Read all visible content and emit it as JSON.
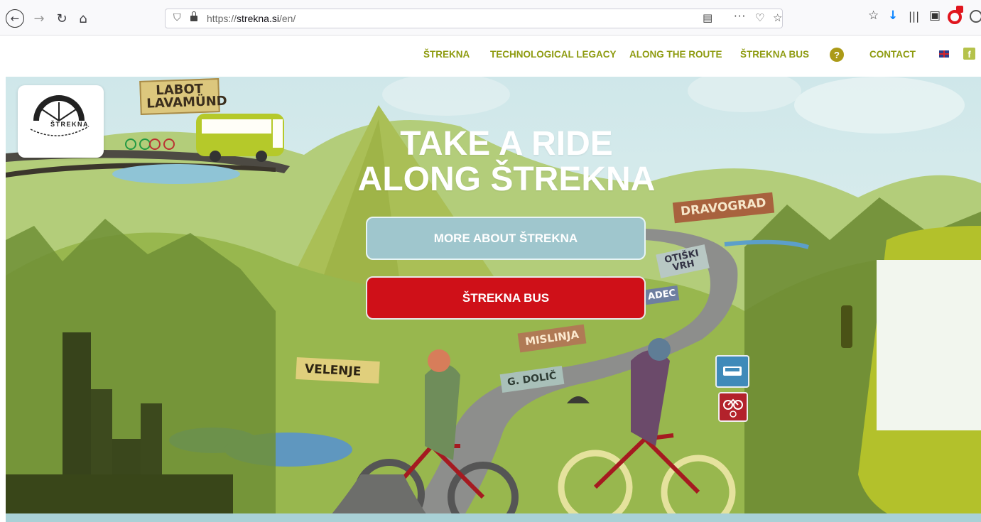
{
  "browser": {
    "url_prefix": "https://",
    "url_domain": "strekna.si",
    "url_path": "/en/",
    "icons": [
      "back-icon",
      "forward-icon",
      "reload-icon",
      "home-icon",
      "shield-icon",
      "lock-icon",
      "reader-view-icon",
      "more-actions-icon",
      "pocket-icon",
      "bookmark-star-icon",
      "library-icon",
      "sidebar-icon",
      "download-icon",
      "opera-icon",
      "account-icon"
    ]
  },
  "header": {
    "logo_text": "ŠTREKNA",
    "nav": [
      {
        "label": "ŠTREKNA"
      },
      {
        "label": "TECHNOLOGICAL LEGACY"
      },
      {
        "label": "ALONG THE ROUTE"
      },
      {
        "label": "ŠTREKNA BUS"
      },
      {
        "label": "CONTACT"
      }
    ],
    "help_symbol": "?",
    "facebook_symbol": "f"
  },
  "hero": {
    "title_line1": "TAKE A RIDE",
    "title_line2": "ALONG ŠTREKNA",
    "primary_button": "MORE ABOUT ŠTREKNA",
    "secondary_button": "ŠTREKNA BUS",
    "signs": {
      "labot_1": "LABOT",
      "labot_2": "LAVAMÜND",
      "dravograd": "DRAVOGRAD",
      "otiski_1": "OTIŠKI",
      "otiski_2": "VRH",
      "radec": "ADEC",
      "mislinja": "MISLINJA",
      "velenje": "VELENJE",
      "dolic": "G. DOLIČ"
    }
  },
  "colors": {
    "nav": "#8e9b10",
    "primary_button": "#9fc6cd",
    "secondary_button": "#cf1018",
    "help": "#ab9a17"
  }
}
